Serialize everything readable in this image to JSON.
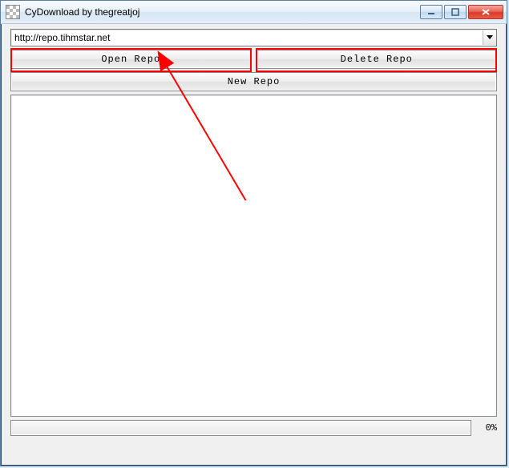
{
  "window": {
    "title": "CyDownload by thegreatjoj"
  },
  "url_field": {
    "value": "http://repo.tihmstar.net"
  },
  "buttons": {
    "open_repo": "Open Repo",
    "delete_repo": "Delete Repo",
    "new_repo": "New Repo"
  },
  "progress": {
    "percent_label": "0%"
  },
  "annotation": {
    "color": "#ff0000"
  }
}
